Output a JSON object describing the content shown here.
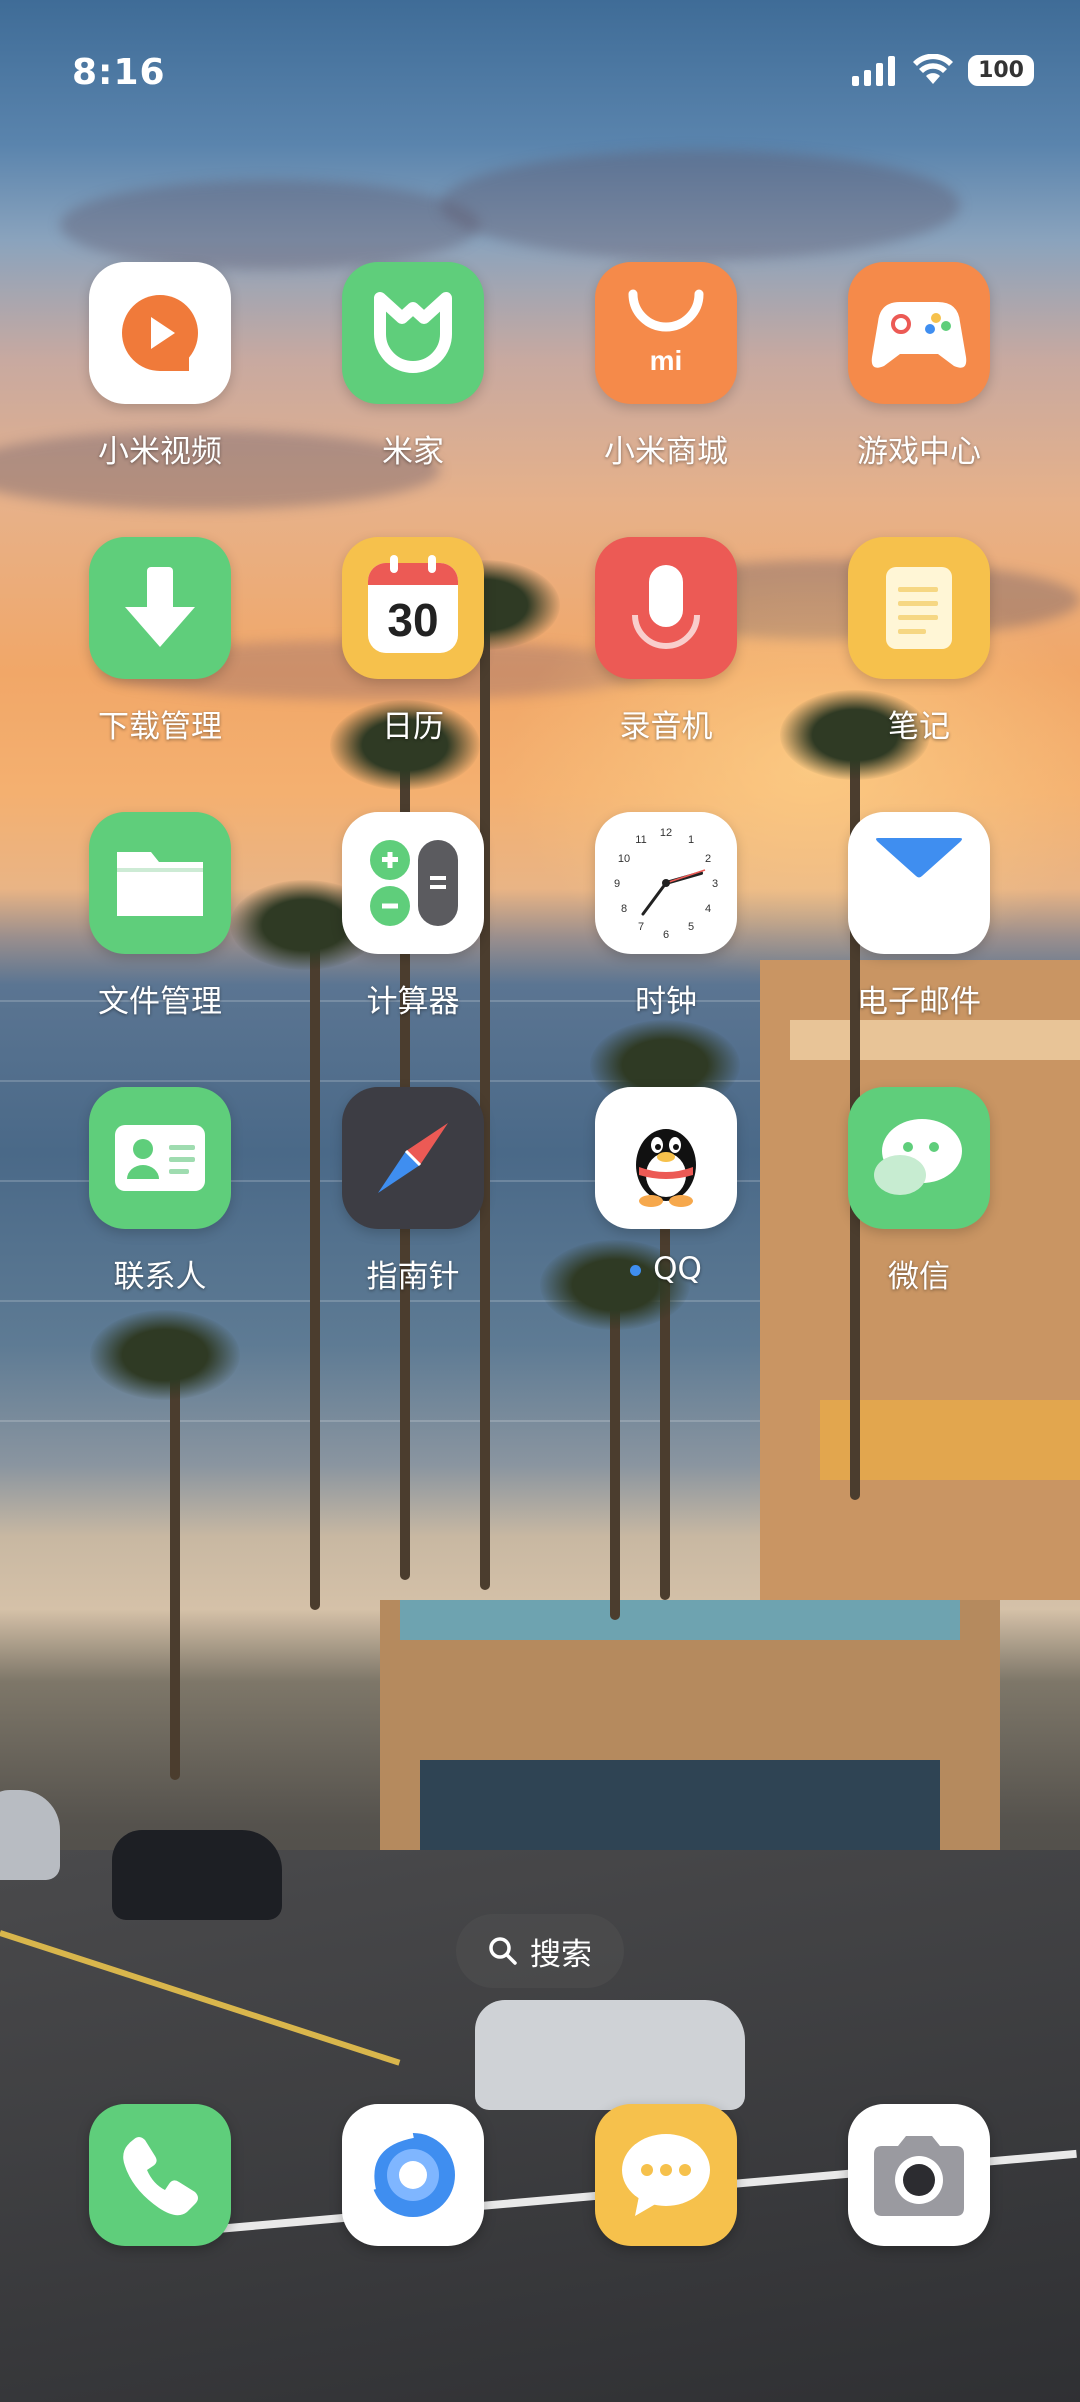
{
  "status_bar": {
    "time": "8:16",
    "battery": "100"
  },
  "apps": [
    {
      "label": "小米视频",
      "icon": "mi-video-icon"
    },
    {
      "label": "米家",
      "icon": "mijia-icon"
    },
    {
      "label": "小米商城",
      "icon": "mi-store-icon"
    },
    {
      "label": "游戏中心",
      "icon": "game-center-icon"
    },
    {
      "label": "下载管理",
      "icon": "download-manager-icon"
    },
    {
      "label": "日历",
      "icon": "calendar-icon",
      "badge_text": "30"
    },
    {
      "label": "录音机",
      "icon": "recorder-icon"
    },
    {
      "label": "笔记",
      "icon": "notes-icon"
    },
    {
      "label": "文件管理",
      "icon": "file-manager-icon"
    },
    {
      "label": "计算器",
      "icon": "calculator-icon"
    },
    {
      "label": "时钟",
      "icon": "clock-icon"
    },
    {
      "label": "电子邮件",
      "icon": "email-icon"
    },
    {
      "label": "联系人",
      "icon": "contacts-icon"
    },
    {
      "label": "指南针",
      "icon": "compass-icon"
    },
    {
      "label": "QQ",
      "icon": "qq-icon",
      "new_indicator": true
    },
    {
      "label": "微信",
      "icon": "wechat-icon"
    }
  ],
  "search": {
    "label": "搜索"
  },
  "dock": [
    {
      "icon": "phone-icon"
    },
    {
      "icon": "browser-icon"
    },
    {
      "icon": "messages-icon"
    },
    {
      "icon": "camera-icon"
    }
  ],
  "colors": {
    "green_icon": "#5fce7b",
    "orange_icon": "#f58a4a",
    "red_icon": "#ec5a55",
    "yellow_icon": "#f6c14c",
    "dark_icon": "#3d3d44",
    "qq_dot": "#3f8ef0"
  }
}
